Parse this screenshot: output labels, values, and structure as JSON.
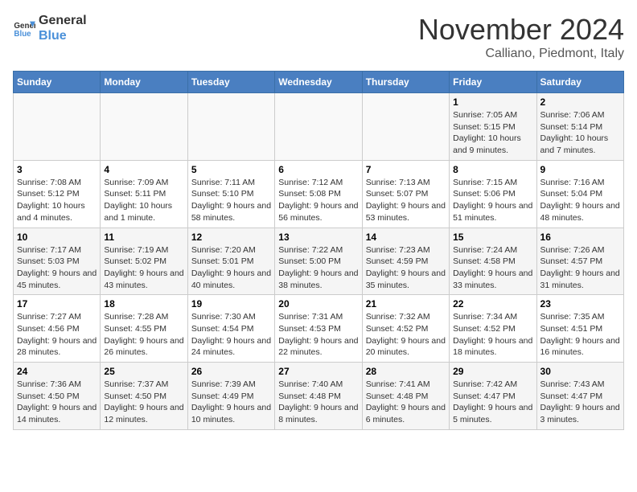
{
  "header": {
    "logo_line1": "General",
    "logo_line2": "Blue",
    "month_title": "November 2024",
    "location": "Calliano, Piedmont, Italy"
  },
  "weekdays": [
    "Sunday",
    "Monday",
    "Tuesday",
    "Wednesday",
    "Thursday",
    "Friday",
    "Saturday"
  ],
  "weeks": [
    [
      {
        "day": "",
        "info": ""
      },
      {
        "day": "",
        "info": ""
      },
      {
        "day": "",
        "info": ""
      },
      {
        "day": "",
        "info": ""
      },
      {
        "day": "",
        "info": ""
      },
      {
        "day": "1",
        "info": "Sunrise: 7:05 AM\nSunset: 5:15 PM\nDaylight: 10 hours and 9 minutes."
      },
      {
        "day": "2",
        "info": "Sunrise: 7:06 AM\nSunset: 5:14 PM\nDaylight: 10 hours and 7 minutes."
      }
    ],
    [
      {
        "day": "3",
        "info": "Sunrise: 7:08 AM\nSunset: 5:12 PM\nDaylight: 10 hours and 4 minutes."
      },
      {
        "day": "4",
        "info": "Sunrise: 7:09 AM\nSunset: 5:11 PM\nDaylight: 10 hours and 1 minute."
      },
      {
        "day": "5",
        "info": "Sunrise: 7:11 AM\nSunset: 5:10 PM\nDaylight: 9 hours and 58 minutes."
      },
      {
        "day": "6",
        "info": "Sunrise: 7:12 AM\nSunset: 5:08 PM\nDaylight: 9 hours and 56 minutes."
      },
      {
        "day": "7",
        "info": "Sunrise: 7:13 AM\nSunset: 5:07 PM\nDaylight: 9 hours and 53 minutes."
      },
      {
        "day": "8",
        "info": "Sunrise: 7:15 AM\nSunset: 5:06 PM\nDaylight: 9 hours and 51 minutes."
      },
      {
        "day": "9",
        "info": "Sunrise: 7:16 AM\nSunset: 5:04 PM\nDaylight: 9 hours and 48 minutes."
      }
    ],
    [
      {
        "day": "10",
        "info": "Sunrise: 7:17 AM\nSunset: 5:03 PM\nDaylight: 9 hours and 45 minutes."
      },
      {
        "day": "11",
        "info": "Sunrise: 7:19 AM\nSunset: 5:02 PM\nDaylight: 9 hours and 43 minutes."
      },
      {
        "day": "12",
        "info": "Sunrise: 7:20 AM\nSunset: 5:01 PM\nDaylight: 9 hours and 40 minutes."
      },
      {
        "day": "13",
        "info": "Sunrise: 7:22 AM\nSunset: 5:00 PM\nDaylight: 9 hours and 38 minutes."
      },
      {
        "day": "14",
        "info": "Sunrise: 7:23 AM\nSunset: 4:59 PM\nDaylight: 9 hours and 35 minutes."
      },
      {
        "day": "15",
        "info": "Sunrise: 7:24 AM\nSunset: 4:58 PM\nDaylight: 9 hours and 33 minutes."
      },
      {
        "day": "16",
        "info": "Sunrise: 7:26 AM\nSunset: 4:57 PM\nDaylight: 9 hours and 31 minutes."
      }
    ],
    [
      {
        "day": "17",
        "info": "Sunrise: 7:27 AM\nSunset: 4:56 PM\nDaylight: 9 hours and 28 minutes."
      },
      {
        "day": "18",
        "info": "Sunrise: 7:28 AM\nSunset: 4:55 PM\nDaylight: 9 hours and 26 minutes."
      },
      {
        "day": "19",
        "info": "Sunrise: 7:30 AM\nSunset: 4:54 PM\nDaylight: 9 hours and 24 minutes."
      },
      {
        "day": "20",
        "info": "Sunrise: 7:31 AM\nSunset: 4:53 PM\nDaylight: 9 hours and 22 minutes."
      },
      {
        "day": "21",
        "info": "Sunrise: 7:32 AM\nSunset: 4:52 PM\nDaylight: 9 hours and 20 minutes."
      },
      {
        "day": "22",
        "info": "Sunrise: 7:34 AM\nSunset: 4:52 PM\nDaylight: 9 hours and 18 minutes."
      },
      {
        "day": "23",
        "info": "Sunrise: 7:35 AM\nSunset: 4:51 PM\nDaylight: 9 hours and 16 minutes."
      }
    ],
    [
      {
        "day": "24",
        "info": "Sunrise: 7:36 AM\nSunset: 4:50 PM\nDaylight: 9 hours and 14 minutes."
      },
      {
        "day": "25",
        "info": "Sunrise: 7:37 AM\nSunset: 4:50 PM\nDaylight: 9 hours and 12 minutes."
      },
      {
        "day": "26",
        "info": "Sunrise: 7:39 AM\nSunset: 4:49 PM\nDaylight: 9 hours and 10 minutes."
      },
      {
        "day": "27",
        "info": "Sunrise: 7:40 AM\nSunset: 4:48 PM\nDaylight: 9 hours and 8 minutes."
      },
      {
        "day": "28",
        "info": "Sunrise: 7:41 AM\nSunset: 4:48 PM\nDaylight: 9 hours and 6 minutes."
      },
      {
        "day": "29",
        "info": "Sunrise: 7:42 AM\nSunset: 4:47 PM\nDaylight: 9 hours and 5 minutes."
      },
      {
        "day": "30",
        "info": "Sunrise: 7:43 AM\nSunset: 4:47 PM\nDaylight: 9 hours and 3 minutes."
      }
    ]
  ]
}
